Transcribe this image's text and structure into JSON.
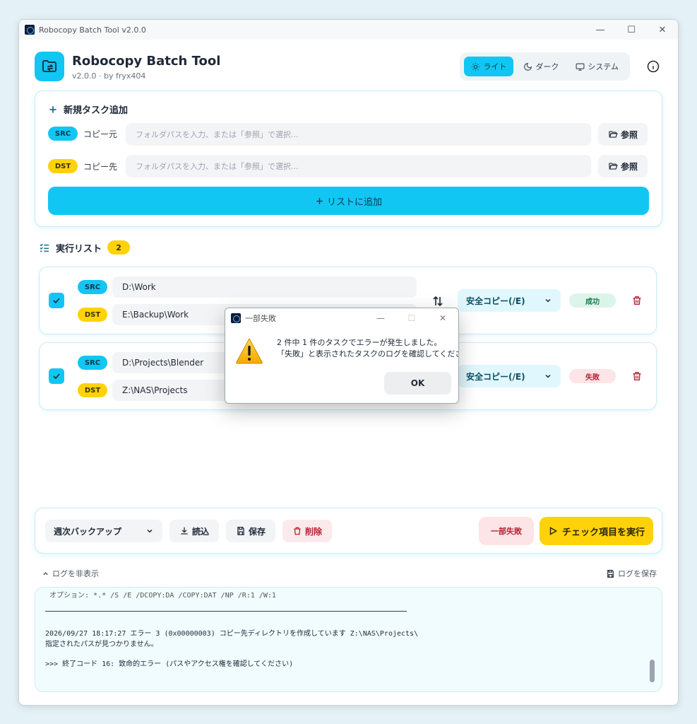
{
  "window": {
    "title": "Robocopy Batch Tool  v2.0.0",
    "minimize": "—",
    "maximize": "☐",
    "close": "✕"
  },
  "header": {
    "app_name": "Robocopy Batch Tool",
    "subtitle": "v2.0.0 · by fryx404",
    "themes": [
      {
        "label": "ライト",
        "icon": "sun-icon",
        "active": true
      },
      {
        "label": "ダーク",
        "icon": "moon-icon",
        "active": false
      },
      {
        "label": "システム",
        "icon": "monitor-icon",
        "active": false
      }
    ]
  },
  "new_task": {
    "title": "新規タスク追加",
    "src_badge": "SRC",
    "src_label": "コピー元",
    "src_placeholder": "フォルダパスを入力、または「参照」で選択...",
    "dst_badge": "DST",
    "dst_label": "コピー先",
    "dst_placeholder": "フォルダパスを入力、または「参照」で選択...",
    "browse_label": "参照",
    "add_label": "リストに追加"
  },
  "exec_list": {
    "title": "実行リスト",
    "count": "2",
    "tasks": [
      {
        "src_badge": "SRC",
        "src": "D:\\Work",
        "dst_badge": "DST",
        "dst": "E:\\Backup\\Work",
        "mode": "安全コピー(/E)",
        "status": "成功"
      },
      {
        "src_badge": "SRC",
        "src": "D:\\Projects\\Blender",
        "dst_badge": "DST",
        "dst": "Z:\\NAS\\Projects",
        "mode": "安全コピー(/E)",
        "status": "失敗"
      }
    ]
  },
  "bottom_bar": {
    "preset": "週次バックアップ",
    "load": "読込",
    "save": "保存",
    "delete": "削除",
    "result": "一部失敗",
    "run": "チェック項目を実行"
  },
  "log": {
    "toggle": "ログを非表示",
    "save": "ログを保存",
    "lines": [
      " オプション: *.* /S /E /DCOPY:DA /COPY:DAT /NP /R:1 /W:1",
      "2026/09/27 18:17:27 エラー 3 (0x00000003) コピー先ディレクトリを作成しています Z:\\NAS\\Projects\\",
      "指定されたパスが見つかりません。",
      ">>> 終了コード 16: 致命的エラー (パスやアクセス権を確認してください)"
    ]
  },
  "dialog": {
    "title": "一部失敗",
    "message_1": "2 件中 1 件のタスクでエラーが発生しました。",
    "message_2": "「失敗」と表示されたタスクのログを確認してください。",
    "ok": "OK"
  },
  "colors": {
    "accent": "#12c6f3",
    "yellow": "#ffd20a",
    "success": "#16794a",
    "danger": "#b42335"
  }
}
